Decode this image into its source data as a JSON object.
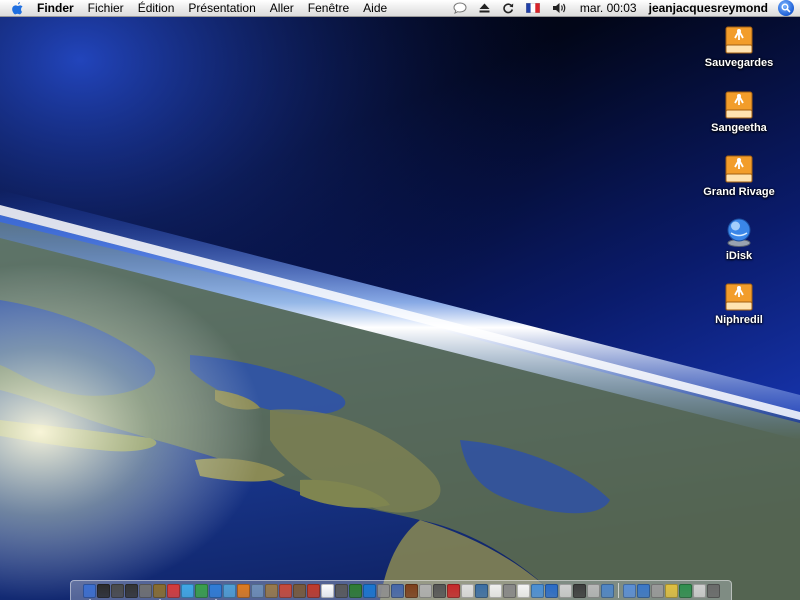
{
  "menubar": {
    "app_name": "Finder",
    "menus": [
      "Fichier",
      "Édition",
      "Présentation",
      "Aller",
      "Fenêtre",
      "Aide"
    ],
    "clock": "mar. 00:03",
    "user": "jeanjacquesreymond",
    "extras_icons": [
      "ichat-status-icon",
      "eject-icon",
      "sync-icon",
      "french-flag-icon",
      "volume-icon",
      "spotlight-icon"
    ]
  },
  "desktop_icons": [
    {
      "label": "Sauvegardes",
      "icon": "firewire-drive-icon"
    },
    {
      "label": "Sangeetha",
      "icon": "firewire-drive-icon"
    },
    {
      "label": "Grand Rivage",
      "icon": "firewire-drive-icon"
    },
    {
      "label": "iDisk",
      "icon": "idisk-icon"
    },
    {
      "label": "Niphredil",
      "icon": "firewire-drive-icon"
    }
  ],
  "dock": {
    "app_colors": [
      "#3b6fd1",
      "#2b2b2b",
      "#4a4a4a",
      "#333333",
      "#707070",
      "#8a6d2e",
      "#d83a3a",
      "#3fa9e8",
      "#38a04a",
      "#2e7dd8",
      "#4f9fd6",
      "#e07b1e",
      "#6f8fb8",
      "#9a7a4a",
      "#c94a3a",
      "#7a5a3a",
      "#c23a2a",
      "#ffffff",
      "#5a5a5a",
      "#2e7d32",
      "#1976d2",
      "#8e8e8e",
      "#4466aa",
      "#7d3f1a",
      "#b0b0b0",
      "#555555",
      "#c62828",
      "#e0e0e0",
      "#3a6ea5",
      "#f0f0f0",
      "#888888",
      "#f5f5f5",
      "#4a8fd6",
      "#2a6cc9",
      "#d0d0d0",
      "#3d3d3d",
      "#b8b8b8",
      "#4f86c6"
    ],
    "doc_colors": [
      "#5b8fd6",
      "#3a78c9",
      "#9a9a9a",
      "#e0c040",
      "#2f8f4e",
      "#d0d0d0",
      "#6a6a6a"
    ],
    "running_indices": [
      0,
      5,
      9
    ]
  }
}
